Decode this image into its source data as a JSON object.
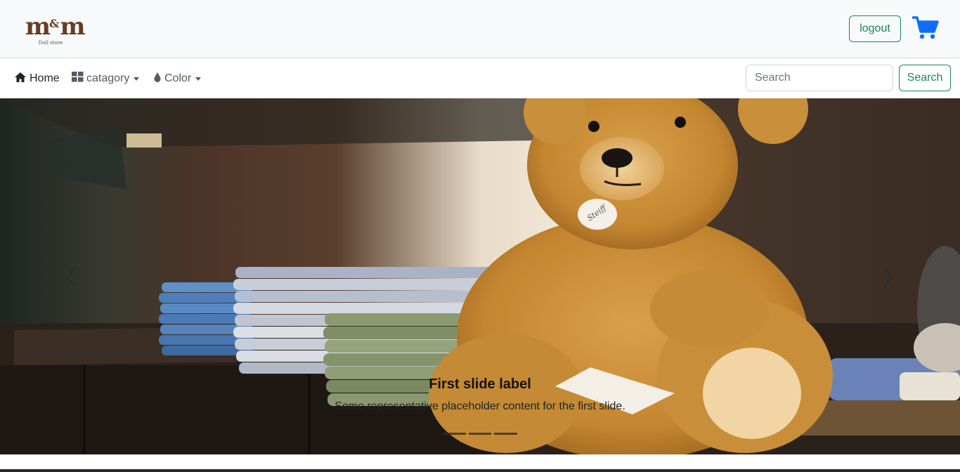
{
  "header": {
    "logo_text": "m&m",
    "logo_subtitle": "Doll store",
    "logout_label": "logout",
    "cart_icon": "cart-icon",
    "accent_color": "#198754",
    "cart_color": "#0d6efd"
  },
  "nav": {
    "home_label": "Home",
    "category_label": "catagory",
    "color_label": "Color"
  },
  "search": {
    "placeholder": "Search",
    "button_label": "Search"
  },
  "carousel": {
    "caption_title": "First slide label",
    "caption_text": "Some representative placeholder content for the first slide.",
    "tag_text": "Steiff",
    "slide_count": 3,
    "active_slide": 1
  }
}
